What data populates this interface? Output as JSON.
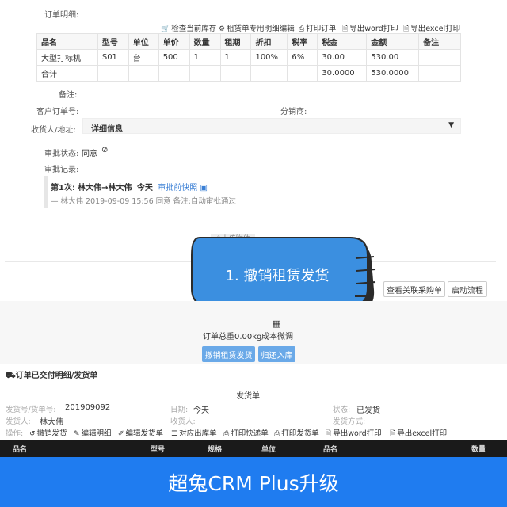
{
  "order": {
    "detail_label": "订单明细:",
    "toolbar": {
      "check_stock": "检查当前库存",
      "lease_edit": "租赁单专用明细编辑",
      "print_order": "打印订单",
      "export_word": "导出word打印",
      "export_excel": "导出excel打印"
    },
    "table": {
      "headers": [
        "品名",
        "型号",
        "单位",
        "单价",
        "数量",
        "租期",
        "折扣",
        "税率",
        "税金",
        "金额",
        "备注"
      ],
      "rows": [
        [
          "大型打标机",
          "S01",
          "台",
          "500",
          "1",
          "1",
          "100%",
          "6%",
          "30.00",
          "530.00",
          ""
        ]
      ],
      "total": {
        "label": "合计",
        "tax": "30.0000",
        "amount": "530.0000"
      }
    },
    "remark_label": "备注:",
    "customer_order_label": "客户订单号:",
    "distributor_label": "分销商:",
    "consignee_label": "收货人/地址:",
    "consignee_select": "详细信息",
    "approval_status_label": "审批状态:",
    "approval_status_value": "同意",
    "approval_record_label": "审批记录:",
    "record": {
      "round": "第1次:",
      "flow": "林大伟→林大伟",
      "day": "今天",
      "snapshot": "审批前快照",
      "detail": "— 林大伟 2019-09-09 15:56 同意 备注:自动审批通过"
    },
    "upload_label": "上传附件",
    "callout": "1. 撤销租赁发货",
    "btn_related_purchase": "查看关联采购单",
    "btn_start_flow": "启动流程",
    "weight": "订单总重0.00kg",
    "cost_adjust": "成本微调",
    "btn_revoke": "撤销租赁发货",
    "btn_return": "归还入库"
  },
  "delivery": {
    "section_title": "订单已交付明细/发货单",
    "doc_title": "发货单",
    "fields": {
      "no_label": "发货号/货单号:",
      "no_value": "201909092",
      "date_label": "日期:",
      "date_value": "今天",
      "status_label": "状态:",
      "status_value": "已发货",
      "shipper_label": "发货人:",
      "shipper_value": "林大伟",
      "receiver_label": "收货人:",
      "method_label": "发货方式:",
      "ops_label": "操作:"
    },
    "ops": {
      "revoke": "撤销发货",
      "edit_detail": "编辑明细",
      "edit_delivery": "编辑发货单",
      "outbound": "对应出库单",
      "print_express": "打印快递单",
      "print_delivery": "打印发货单",
      "export_word": "导出word打印",
      "export_excel": "导出excel打印"
    },
    "table_headers": [
      "品名",
      "型号",
      "规格",
      "单位",
      "品名",
      "数量"
    ]
  },
  "banner": "超兔CRM Plus升级",
  "colors": {
    "banner": "#1f7cf0",
    "callout": "#3b8fe0",
    "button": "#6aa9e8",
    "link": "#3a7fd5"
  }
}
